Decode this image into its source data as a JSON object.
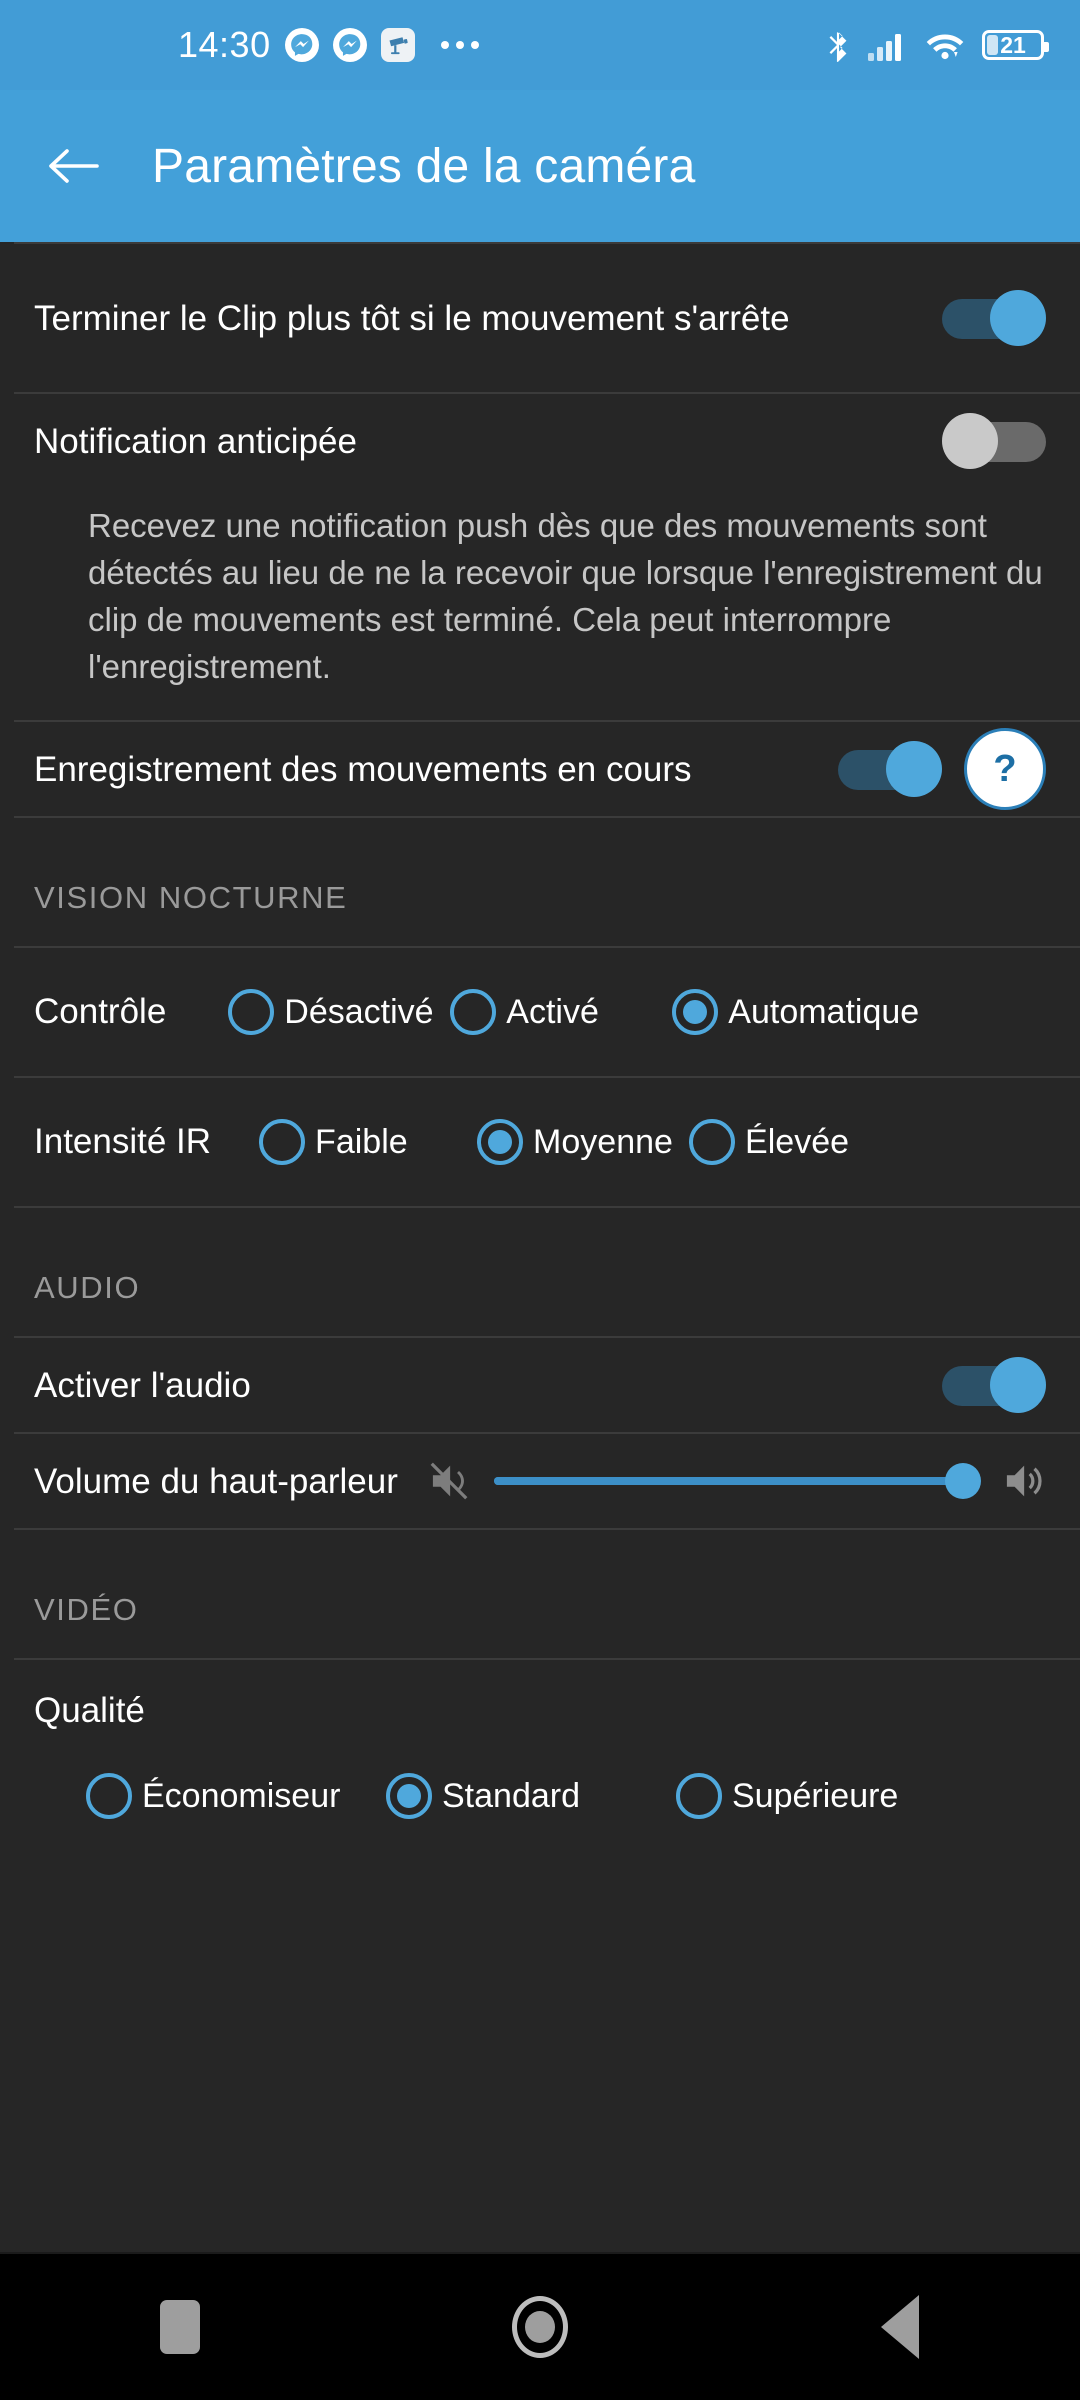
{
  "statusbar": {
    "clock": "14:30",
    "battery_percent": "21",
    "icons": [
      "messenger-icon",
      "messenger-icon",
      "camera-notification-icon",
      "more-dots-icon",
      "bluetooth-icon",
      "cellular-signal-icon",
      "wifi-icon",
      "battery-icon"
    ]
  },
  "appbar": {
    "back_icon": "back-arrow-icon",
    "title": "Paramètres de la caméra"
  },
  "settings": {
    "end_clip": {
      "label": "Terminer le Clip plus tôt si le mouvement s'arrête",
      "toggle_state": "on"
    },
    "early_notification": {
      "label": "Notification anticipée",
      "toggle_state": "off",
      "description": "Recevez une notification push dès que des mouvements sont détectés au lieu de ne la recevoir que lorsque l'enregistrement du clip de mouvements est terminé. Cela peut interrompre l'enregistrement."
    },
    "motion_recording": {
      "label": "Enregistrement des mouvements en cours",
      "toggle_state": "on",
      "help_label": "?"
    }
  },
  "night_vision": {
    "section_title": "VISION NOCTURNE",
    "control": {
      "label": "Contrôle",
      "options": [
        {
          "label": "Désactivé",
          "selected": false
        },
        {
          "label": "Activé",
          "selected": false
        },
        {
          "label": "Automatique",
          "selected": true
        }
      ]
    },
    "ir_intensity": {
      "label": "Intensité IR",
      "options": [
        {
          "label": "Faible",
          "selected": false
        },
        {
          "label": "Moyenne",
          "selected": true
        },
        {
          "label": "Élevée",
          "selected": false
        }
      ]
    }
  },
  "audio": {
    "section_title": "AUDIO",
    "enable_audio": {
      "label": "Activer l'audio",
      "toggle_state": "on"
    },
    "speaker_volume": {
      "label": "Volume du haut-parleur",
      "mute_icon": "volume-mute-icon",
      "max_icon": "volume-up-icon",
      "value_percent": 97
    }
  },
  "video": {
    "section_title": "VIDÉO",
    "quality": {
      "label": "Qualité",
      "options": [
        {
          "label": "Économiseur",
          "selected": false
        },
        {
          "label": "Standard",
          "selected": true
        },
        {
          "label": "Supérieure",
          "selected": false
        }
      ]
    }
  },
  "navbar": {
    "recents": "recent-apps-icon",
    "home": "home-icon",
    "back": "back-nav-icon"
  },
  "colors": {
    "accent": "#4FA8DC",
    "appbar": "#43A0D9",
    "background": "#262626",
    "text": "#FFFFFF",
    "muted_text": "#9A9A9A"
  }
}
